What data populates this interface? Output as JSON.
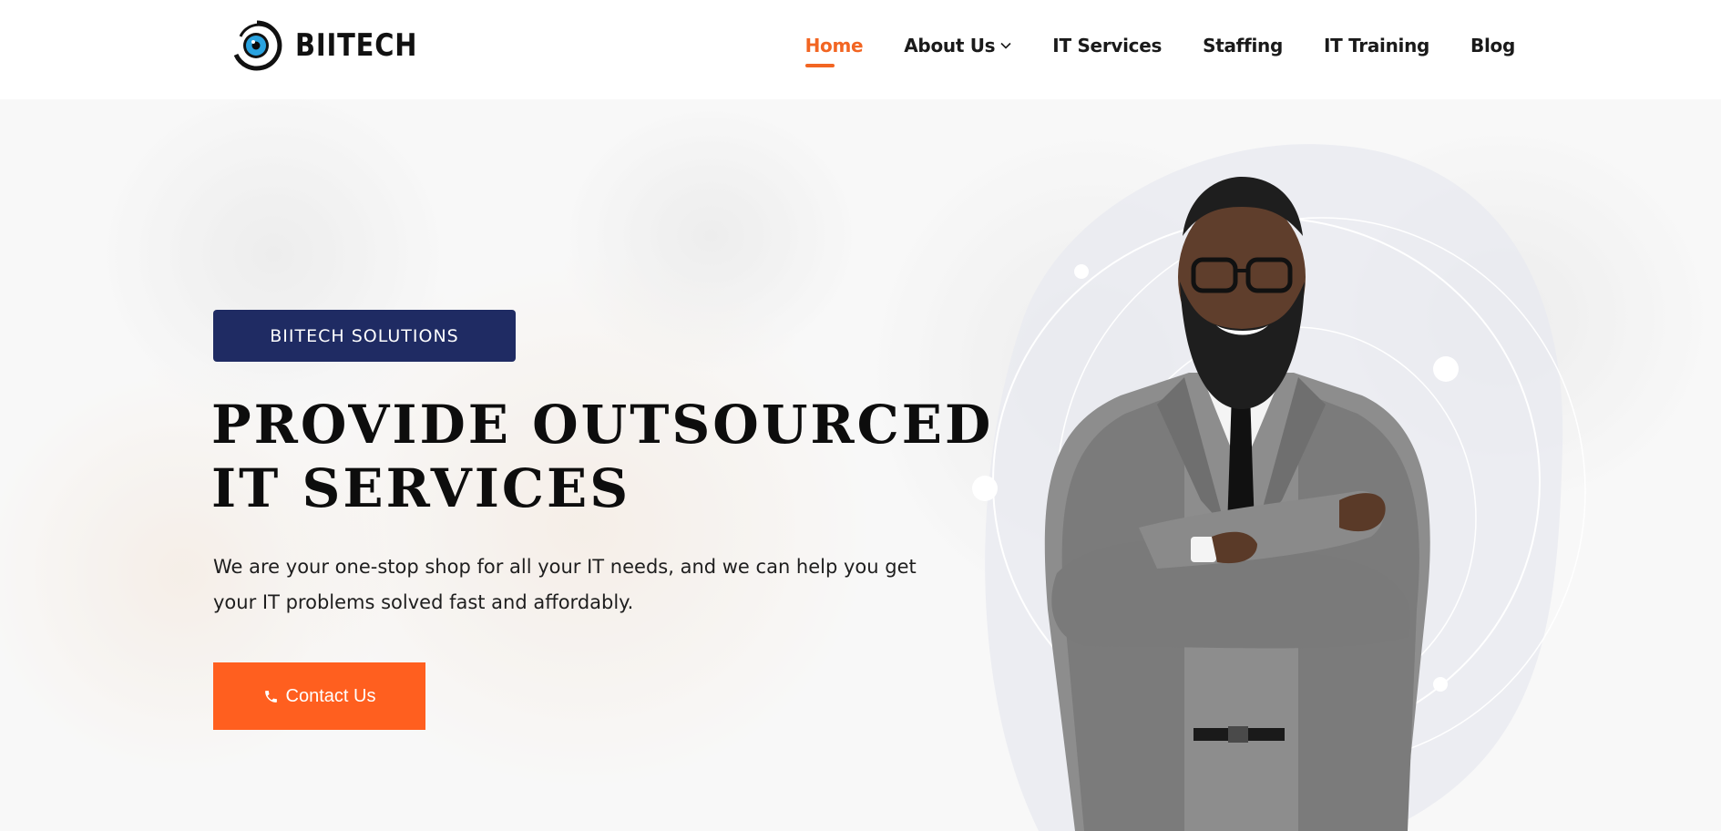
{
  "brand": {
    "name": "BIITECH",
    "accent": "#f26522",
    "navy": "#1f2b63",
    "cta": "#ff5f1f"
  },
  "nav": {
    "items": [
      {
        "label": "Home",
        "active": true
      },
      {
        "label": "About Us",
        "active": false,
        "has_dropdown": true
      },
      {
        "label": "IT Services",
        "active": false
      },
      {
        "label": "Staffing",
        "active": false
      },
      {
        "label": "IT Training",
        "active": false
      },
      {
        "label": "Blog",
        "active": false
      }
    ]
  },
  "hero": {
    "badge": "BIITECH SOLUTIONS",
    "headline_line1": "PROVIDE OUTSOURCED",
    "headline_line2": "IT SERVICES",
    "lede": "We are your one-stop shop for all your IT needs, and we can help you get your IT problems solved fast and affordably.",
    "cta_label": "Contact Us",
    "cta_icon": "phone-icon"
  },
  "icons": {
    "logo": "eye-swirl-logo-icon",
    "dropdown": "chevron-down-icon"
  }
}
